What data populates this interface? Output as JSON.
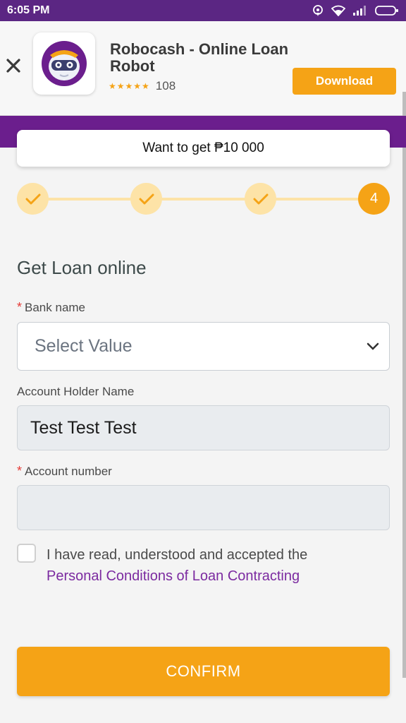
{
  "status_bar": {
    "time": "6:05 PM",
    "icons": [
      "hotspot-icon",
      "wifi-icon",
      "signal-icon",
      "battery-icon"
    ]
  },
  "ad": {
    "title": "Robocash - Online Loan Robot",
    "stars": "★★★★★",
    "rating": 4.5,
    "rating_count": "108",
    "download_label": "Download",
    "close_icon": "close-icon",
    "logo_icon": "robot-logo-icon"
  },
  "promo": {
    "text": "Want to get ₱10 000"
  },
  "stepper": {
    "current_step": "4",
    "completed_steps": 3,
    "total_steps": 4
  },
  "form": {
    "title": "Get Loan online",
    "bank": {
      "label": "Bank name",
      "required": true,
      "value": "Select Value"
    },
    "holder": {
      "label": "Account Holder Name",
      "value": "Test Test Test"
    },
    "account": {
      "label": "Account number",
      "required": true,
      "value": ""
    },
    "consent_text": "I have read, understood and accepted the",
    "consent_link": "Personal Conditions of Loan Contracting",
    "confirm_label": "CONFIRM"
  },
  "colors": {
    "accent": "#f5a316",
    "brand_purple": "#6b1e8d",
    "link": "#7b2aa0",
    "required": "#e53935"
  }
}
